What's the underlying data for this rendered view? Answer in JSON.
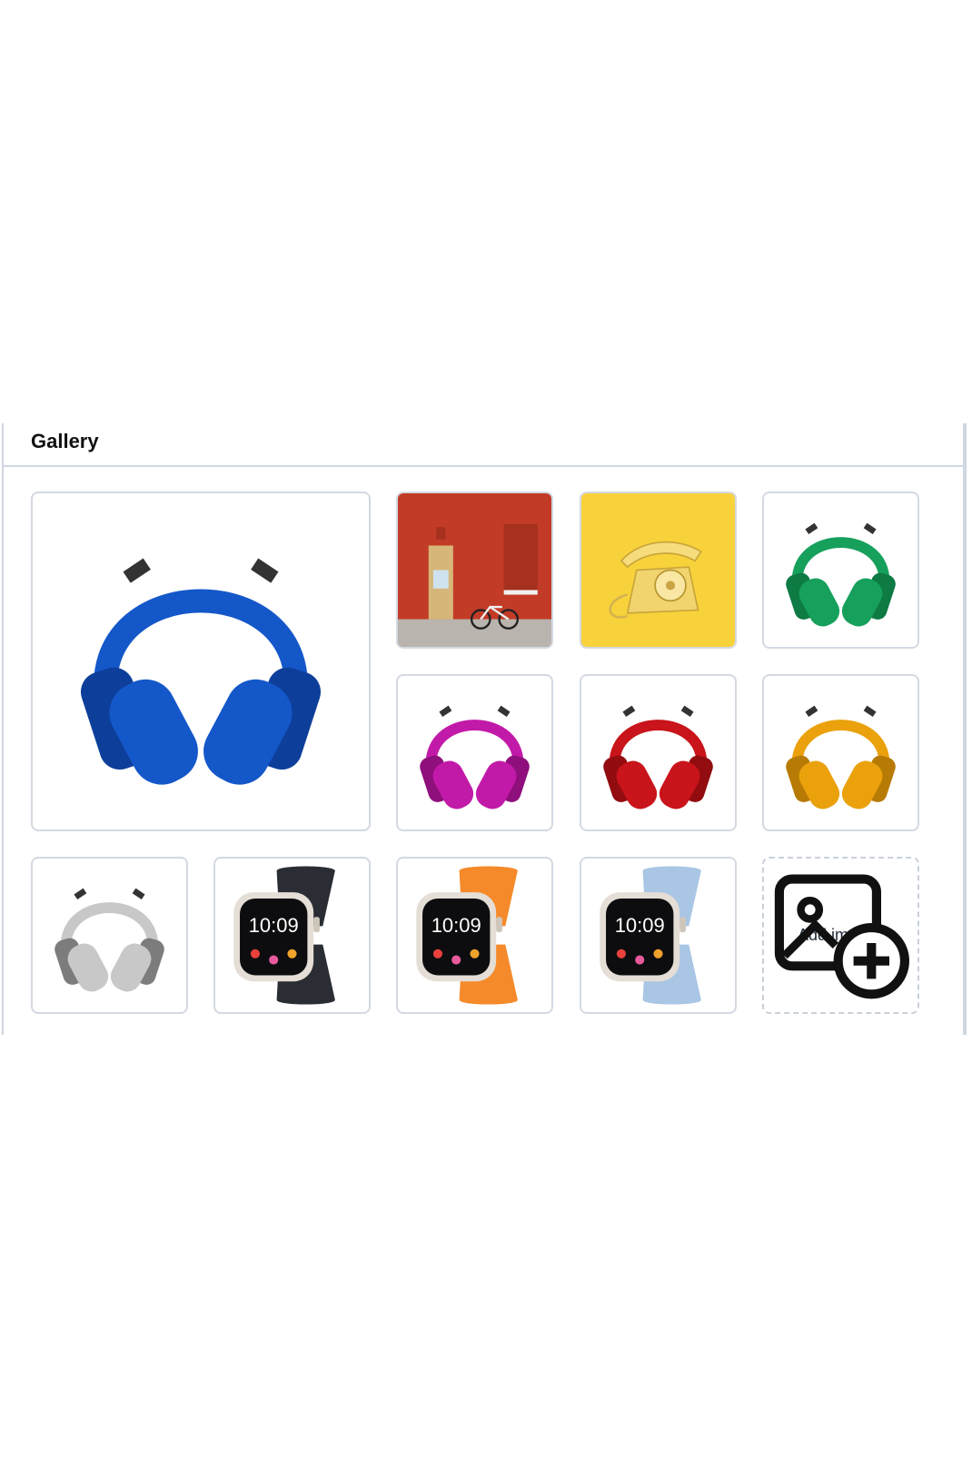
{
  "gallery": {
    "title": "Gallery",
    "add_label": "Add images",
    "images": [
      {
        "name": "blue-headphones",
        "kind": "headphones",
        "color": "#1457c9",
        "dark": "#0d3f9a"
      },
      {
        "name": "red-brick-building",
        "kind": "building",
        "color": "#c23b26"
      },
      {
        "name": "yellow-telephone",
        "kind": "phone",
        "color": "#f8d23a"
      },
      {
        "name": "green-headphones",
        "kind": "headphones",
        "color": "#16a05c",
        "dark": "#0e7a44"
      },
      {
        "name": "magenta-headphones",
        "kind": "headphones",
        "color": "#c21aa8",
        "dark": "#8f0f7c"
      },
      {
        "name": "red-headphones",
        "kind": "headphones",
        "color": "#c8141a",
        "dark": "#920c10"
      },
      {
        "name": "orange-headphones",
        "kind": "headphones",
        "color": "#eaa10c",
        "dark": "#b77b05"
      },
      {
        "name": "silver-headphones",
        "kind": "headphones",
        "color": "#c8c8c8",
        "dark": "#7c7c7c"
      },
      {
        "name": "black-band-watch",
        "kind": "watch",
        "color": "#2a2d34",
        "time": "10:09"
      },
      {
        "name": "orange-band-watch",
        "kind": "watch",
        "color": "#f58a2a",
        "time": "10:09"
      },
      {
        "name": "light-blue-band-watch",
        "kind": "watch",
        "color": "#a9c6e4",
        "time": "10:09"
      }
    ]
  }
}
